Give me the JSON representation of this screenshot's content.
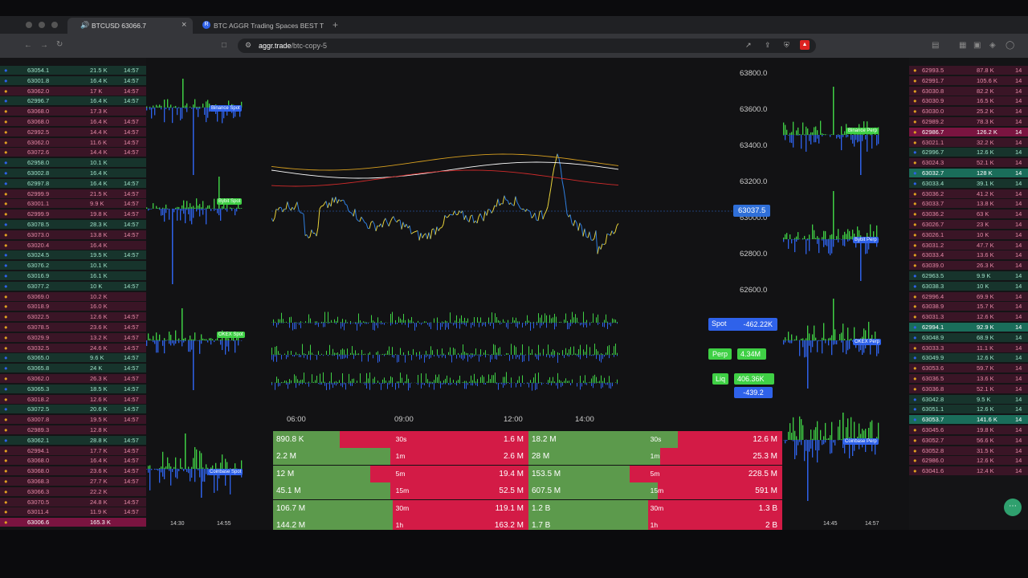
{
  "browser": {
    "tabs": [
      {
        "label": "BTCUSD 63066.7",
        "active": true
      },
      {
        "label": "BTC AGGR Trading Spaces BEST T",
        "active": false
      }
    ],
    "url_domain": "aggr.trade",
    "url_path": "/btc-copy-5"
  },
  "left_trades": [
    {
      "price": "63054.1",
      "size": "21.5 K",
      "time": "14:57",
      "side": "buy"
    },
    {
      "price": "63001.8",
      "size": "16.4 K",
      "time": "14:57",
      "side": "buy"
    },
    {
      "price": "63062.0",
      "size": "17 K",
      "time": "14:57",
      "side": "sell"
    },
    {
      "price": "62996.7",
      "size": "16.4 K",
      "time": "14:57",
      "side": "buy"
    },
    {
      "price": "63068.0",
      "size": "17.3 K",
      "time": "",
      "side": "sell"
    },
    {
      "price": "63068.0",
      "size": "16.4 K",
      "time": "14:57",
      "side": "sell"
    },
    {
      "price": "62992.5",
      "size": "14.4 K",
      "time": "14:57",
      "side": "sell"
    },
    {
      "price": "63062.0",
      "size": "11.6 K",
      "time": "14:57",
      "side": "sell"
    },
    {
      "price": "63072.6",
      "size": "14.4 K",
      "time": "14:57",
      "side": "sell"
    },
    {
      "price": "62958.0",
      "size": "10.1 K",
      "time": "",
      "side": "buy"
    },
    {
      "price": "63002.8",
      "size": "16.4 K",
      "time": "",
      "side": "buy"
    },
    {
      "price": "62997.8",
      "size": "16.4 K",
      "time": "14:57",
      "side": "buy"
    },
    {
      "price": "62999.9",
      "size": "21.5 K",
      "time": "14:57",
      "side": "sell"
    },
    {
      "price": "63001.1",
      "size": "9.9 K",
      "time": "14:57",
      "side": "sell"
    },
    {
      "price": "62999.9",
      "size": "19.8 K",
      "time": "14:57",
      "side": "sell"
    },
    {
      "price": "63078.5",
      "size": "28.3 K",
      "time": "14:57",
      "side": "buy"
    },
    {
      "price": "63073.0",
      "size": "13.8 K",
      "time": "14:57",
      "side": "sell"
    },
    {
      "price": "63020.4",
      "size": "16.4 K",
      "time": "",
      "side": "sell"
    },
    {
      "price": "63024.5",
      "size": "19.5 K",
      "time": "14:57",
      "side": "buy"
    },
    {
      "price": "63076.2",
      "size": "10.1 K",
      "time": "",
      "side": "buy"
    },
    {
      "price": "63016.9",
      "size": "16.1 K",
      "time": "",
      "side": "buy"
    },
    {
      "price": "63077.2",
      "size": "10 K",
      "time": "14:57",
      "side": "buy"
    },
    {
      "price": "63069.0",
      "size": "10.2 K",
      "time": "",
      "side": "sell"
    },
    {
      "price": "63018.9",
      "size": "16.0 K",
      "time": "",
      "side": "sell"
    },
    {
      "price": "63022.5",
      "size": "12.6 K",
      "time": "14:57",
      "side": "sell"
    },
    {
      "price": "63078.5",
      "size": "23.6 K",
      "time": "14:57",
      "side": "sell"
    },
    {
      "price": "63029.9",
      "size": "13.2 K",
      "time": "14:57",
      "side": "sell"
    },
    {
      "price": "63032.5",
      "size": "24.6 K",
      "time": "14:57",
      "side": "sell"
    },
    {
      "price": "63065.0",
      "size": "9.6 K",
      "time": "14:57",
      "side": "buy"
    },
    {
      "price": "63065.8",
      "size": "24 K",
      "time": "14:57",
      "side": "buy"
    },
    {
      "price": "63062.0",
      "size": "26.3 K",
      "time": "14:57",
      "side": "sell"
    },
    {
      "price": "63065.3",
      "size": "18.5 K",
      "time": "14:57",
      "side": "buy"
    },
    {
      "price": "63018.2",
      "size": "12.6 K",
      "time": "14:57",
      "side": "sell"
    },
    {
      "price": "63072.5",
      "size": "20.6 K",
      "time": "14:57",
      "side": "buy"
    },
    {
      "price": "63007.8",
      "size": "19.5 K",
      "time": "14:57",
      "side": "sell"
    },
    {
      "price": "62989.3",
      "size": "12.8 K",
      "time": "",
      "side": "sell"
    },
    {
      "price": "63062.1",
      "size": "28.8 K",
      "time": "14:57",
      "side": "buy"
    },
    {
      "price": "62994.1",
      "size": "17.7 K",
      "time": "14:57",
      "side": "sell"
    },
    {
      "price": "63068.0",
      "size": "16.4 K",
      "time": "14:57",
      "side": "sell"
    },
    {
      "price": "63068.0",
      "size": "23.6 K",
      "time": "14:57",
      "side": "sell"
    },
    {
      "price": "63068.3",
      "size": "27.7 K",
      "time": "14:57",
      "side": "sell"
    },
    {
      "price": "63066.3",
      "size": "22.2 K",
      "time": "",
      "side": "sell"
    },
    {
      "price": "63070.5",
      "size": "24.8 K",
      "time": "14:57",
      "side": "sell"
    },
    {
      "price": "63011.4",
      "size": "11.9 K",
      "time": "14:57",
      "side": "sell"
    },
    {
      "price": "63006.6",
      "size": "165.3 K",
      "time": "",
      "side": "big-sell"
    }
  ],
  "right_trades": [
    {
      "price": "62993.5",
      "size": "87.8 K",
      "time": "14",
      "side": "sell"
    },
    {
      "price": "62991.7",
      "size": "105.6 K",
      "time": "14",
      "side": "sell"
    },
    {
      "price": "63030.8",
      "size": "82.2 K",
      "time": "14",
      "side": "sell"
    },
    {
      "price": "63030.9",
      "size": "16.5 K",
      "time": "14",
      "side": "sell"
    },
    {
      "price": "63030.0",
      "size": "25.2 K",
      "time": "14",
      "side": "sell"
    },
    {
      "price": "62989.2",
      "size": "78.3 K",
      "time": "14",
      "side": "sell"
    },
    {
      "price": "62986.7",
      "size": "126.2 K",
      "time": "14",
      "side": "big-sell"
    },
    {
      "price": "63021.1",
      "size": "32.2 K",
      "time": "14",
      "side": "sell"
    },
    {
      "price": "62996.7",
      "size": "12.6 K",
      "time": "14",
      "side": "buy"
    },
    {
      "price": "63024.3",
      "size": "52.1 K",
      "time": "14",
      "side": "sell"
    },
    {
      "price": "63032.7",
      "size": "128 K",
      "time": "14",
      "side": "big-buy"
    },
    {
      "price": "63033.4",
      "size": "39.1 K",
      "time": "14",
      "side": "buy"
    },
    {
      "price": "63036.2",
      "size": "41.2 K",
      "time": "14",
      "side": "sell"
    },
    {
      "price": "63033.7",
      "size": "13.8 K",
      "time": "14",
      "side": "sell"
    },
    {
      "price": "63036.2",
      "size": "63 K",
      "time": "14",
      "side": "sell"
    },
    {
      "price": "63026.7",
      "size": "23 K",
      "time": "14",
      "side": "sell"
    },
    {
      "price": "63026.1",
      "size": "10 K",
      "time": "14",
      "side": "sell"
    },
    {
      "price": "63031.2",
      "size": "47.7 K",
      "time": "14",
      "side": "sell"
    },
    {
      "price": "63033.4",
      "size": "13.6 K",
      "time": "14",
      "side": "sell"
    },
    {
      "price": "63039.0",
      "size": "26.3 K",
      "time": "14",
      "side": "sell"
    },
    {
      "price": "62963.5",
      "size": "9.9 K",
      "time": "14",
      "side": "buy"
    },
    {
      "price": "63038.3",
      "size": "10 K",
      "time": "14",
      "side": "buy"
    },
    {
      "price": "62996.4",
      "size": "69.9 K",
      "time": "14",
      "side": "sell"
    },
    {
      "price": "63038.9",
      "size": "15.7 K",
      "time": "14",
      "side": "sell"
    },
    {
      "price": "63031.3",
      "size": "12.6 K",
      "time": "14",
      "side": "sell"
    },
    {
      "price": "62994.1",
      "size": "92.9 K",
      "time": "14",
      "side": "big-buy"
    },
    {
      "price": "63048.9",
      "size": "68.9 K",
      "time": "14",
      "side": "buy"
    },
    {
      "price": "63033.3",
      "size": "11.1 K",
      "time": "14",
      "side": "sell"
    },
    {
      "price": "63049.9",
      "size": "12.6 K",
      "time": "14",
      "side": "buy"
    },
    {
      "price": "63053.6",
      "size": "59.7 K",
      "time": "14",
      "side": "sell"
    },
    {
      "price": "63036.5",
      "size": "13.6 K",
      "time": "14",
      "side": "sell"
    },
    {
      "price": "63036.8",
      "size": "52.1 K",
      "time": "14",
      "side": "sell"
    },
    {
      "price": "63042.8",
      "size": "9.5 K",
      "time": "14",
      "side": "buy"
    },
    {
      "price": "63051.1",
      "size": "12.6 K",
      "time": "14",
      "side": "buy"
    },
    {
      "price": "63053.7",
      "size": "141.6 K",
      "time": "14",
      "side": "big-buy"
    },
    {
      "price": "63045.6",
      "size": "19.8 K",
      "time": "14",
      "side": "sell"
    },
    {
      "price": "63052.7",
      "size": "56.6 K",
      "time": "14",
      "side": "sell"
    },
    {
      "price": "63052.8",
      "size": "31.5 K",
      "time": "14",
      "side": "sell"
    },
    {
      "price": "62986.0",
      "size": "12.6 K",
      "time": "14",
      "side": "sell"
    },
    {
      "price": "63041.6",
      "size": "12.4 K",
      "time": "14",
      "side": "sell"
    }
  ],
  "left_panes": {
    "labels": [
      "Binance Spot",
      "Bybit Spot",
      "OKEX Spot",
      "Coinbase Spot"
    ],
    "time_ticks": [
      "14:30",
      "14:55"
    ]
  },
  "right_panes": {
    "labels": [
      "Binance Perp",
      "Bybit Perp",
      "OKEX Perp",
      "Coinbase Perp"
    ],
    "time_ticks": [
      "14:45",
      "14:57"
    ]
  },
  "main_chart": {
    "price_ticks": [
      "63800.0",
      "63600.0",
      "63400.0",
      "63200.0",
      "63000.0",
      "62800.0",
      "62600.0"
    ],
    "current_price": "63037.5",
    "time_ticks": [
      "06:00",
      "09:00",
      "12:00",
      "14:00"
    ],
    "badges": {
      "spot_label": "Spot",
      "spot_value": "-462.22K",
      "perp_label": "Perp",
      "perp_value": "4.34M",
      "liq_label": "Liq",
      "liq_value": "406.36K",
      "liq_extra": "-439.2"
    },
    "colors": {
      "buy": "#3fd045",
      "sell": "#2f62ea",
      "up": "#6ab34f",
      "down": "#cf1e3d",
      "price": "#2f6fd8"
    }
  },
  "stats_spot": [
    {
      "buy": "890.8 K",
      "interval": "30s",
      "sell": "1.6 M",
      "buy_ratio": 0.26
    },
    {
      "buy": "2.2 M",
      "interval": "1m",
      "sell": "2.6 M",
      "buy_ratio": 0.46
    },
    {
      "buy": "12 M",
      "interval": "5m",
      "sell": "19.4 M",
      "buy_ratio": 0.38
    },
    {
      "buy": "45.1 M",
      "interval": "15m",
      "sell": "52.5 M",
      "buy_ratio": 0.46
    },
    {
      "buy": "106.7 M",
      "interval": "30m",
      "sell": "119.1 M",
      "buy_ratio": 0.47
    },
    {
      "buy": "144.2 M",
      "interval": "1h",
      "sell": "163.2 M",
      "buy_ratio": 0.47
    }
  ],
  "stats_perp": [
    {
      "buy": "18.2 M",
      "interval": "30s",
      "sell": "12.6 M",
      "buy_ratio": 0.59
    },
    {
      "buy": "28 M",
      "interval": "1m",
      "sell": "25.3 M",
      "buy_ratio": 0.52
    },
    {
      "buy": "153.5 M",
      "interval": "5m",
      "sell": "228.5 M",
      "buy_ratio": 0.4
    },
    {
      "buy": "607.5 M",
      "interval": "15m",
      "sell": "591 M",
      "buy_ratio": 0.51
    },
    {
      "buy": "1.2 B",
      "interval": "30m",
      "sell": "1.3 B",
      "buy_ratio": 0.47
    },
    {
      "buy": "1.7 B",
      "interval": "1h",
      "sell": "2 B",
      "buy_ratio": 0.47
    }
  ]
}
